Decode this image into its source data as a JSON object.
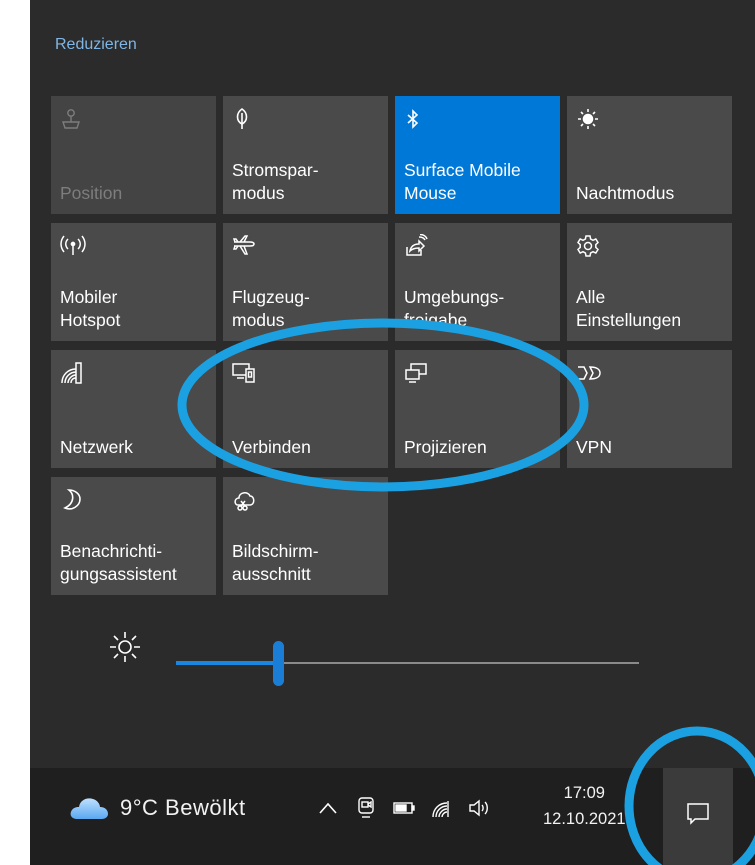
{
  "action_center": {
    "collapse_label": "Reduzieren",
    "accent_color": "#0078d7",
    "tiles": [
      {
        "label": "Position",
        "icon": "location-pin-icon",
        "state": "disabled"
      },
      {
        "label": "Stromspar-\nmodus",
        "icon": "battery-saver-leaf-icon",
        "state": "off"
      },
      {
        "label": "Surface Mobile\nMouse",
        "icon": "bluetooth-icon",
        "state": "on"
      },
      {
        "label": "Nachtmodus",
        "icon": "night-light-sun-icon",
        "state": "off"
      },
      {
        "label": "Mobiler\nHotspot",
        "icon": "hotspot-icon",
        "state": "off"
      },
      {
        "label": "Flugzeug-\nmodus",
        "icon": "airplane-icon",
        "state": "off"
      },
      {
        "label": "Umgebungs-\nfreigabe",
        "icon": "nearby-share-icon",
        "state": "off"
      },
      {
        "label": "Alle\nEinstellungen",
        "icon": "gear-icon",
        "state": "off"
      },
      {
        "label": "Netzwerk",
        "icon": "network-wifi-icon",
        "state": "off"
      },
      {
        "label": "Verbinden",
        "icon": "connect-devices-icon",
        "state": "off"
      },
      {
        "label": "Projizieren",
        "icon": "project-screens-icon",
        "state": "off"
      },
      {
        "label": "VPN",
        "icon": "vpn-icon",
        "state": "off"
      },
      {
        "label": "Benachrichti-\ngungsassistent",
        "icon": "focus-assist-moon-icon",
        "state": "off"
      },
      {
        "label": "Bildschirm-\nausschnitt",
        "icon": "snip-sketch-icon",
        "state": "off"
      }
    ],
    "brightness": {
      "icon": "brightness-sun-icon",
      "level_fraction": 0.22
    }
  },
  "taskbar": {
    "weather_text": "9°C  Bewölkt",
    "weather_icon": "cloud-icon",
    "tray_icons": [
      "chevron-up-icon",
      "meet-now-icon",
      "battery-icon",
      "wifi-icon",
      "volume-icon"
    ],
    "time": "17:09",
    "date": "12.10.2021",
    "notification_icon": "action-center-icon"
  },
  "annotation_color": "#1ba1e2"
}
